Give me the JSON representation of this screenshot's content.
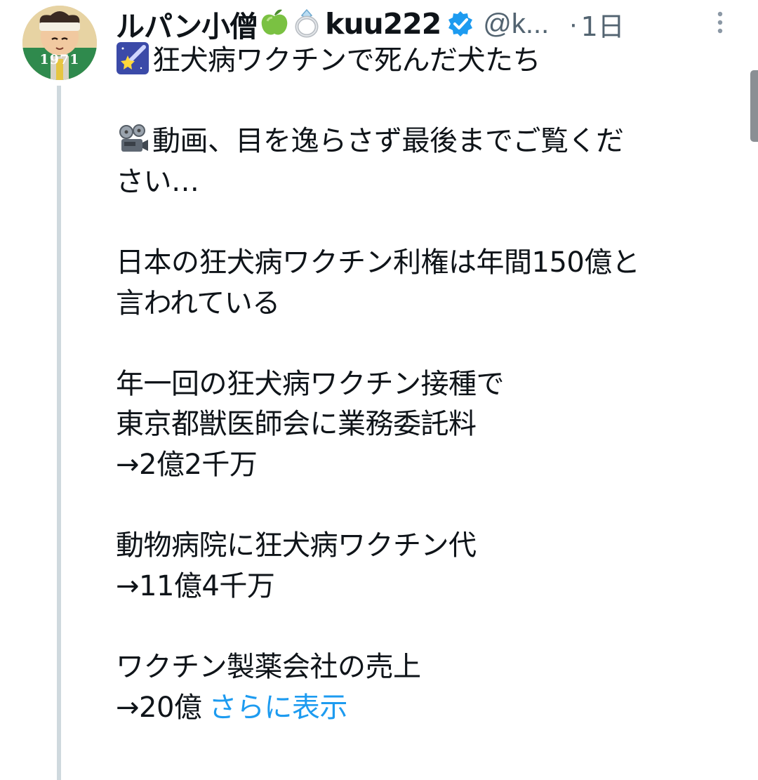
{
  "author": {
    "display_name": "ルパン小僧",
    "name_emojis": [
      "green-apple-emoji",
      "ring-emoji"
    ],
    "name_suffix": "kuu222",
    "handle": "@k...",
    "separator": "·",
    "timestamp": "1日",
    "verified": true,
    "avatar_caption": "1971"
  },
  "tweet": {
    "lines": [
      {
        "icon": "shooting-star-icon",
        "text": "狂犬病ワクチンで死んだ犬たち"
      },
      {
        "gap": true
      },
      {
        "icon": "film-projector-icon",
        "text": "動画、目を逸らさず最後までご覧くだ"
      },
      {
        "text": "さい…"
      },
      {
        "gap": true
      },
      {
        "text": "日本の狂犬病ワクチン利権は年間150億と"
      },
      {
        "text": "言われている"
      },
      {
        "gap": true
      },
      {
        "text": "年一回の狂犬病ワクチン接種で"
      },
      {
        "text": "東京都獣医師会に業務委託料"
      },
      {
        "text": "→2億2千万"
      },
      {
        "gap": true
      },
      {
        "text": "動物病院に狂犬病ワクチン代"
      },
      {
        "text": "→11億4千万"
      },
      {
        "gap": true
      },
      {
        "text": "ワクチン製薬会社の売上"
      },
      {
        "text": "→20億"
      }
    ],
    "show_more_label": "さらに表示"
  },
  "colors": {
    "text": "#0f1419",
    "secondary": "#536471",
    "link": "#1d9bf0",
    "verified": "#1d9bf0",
    "thread_line": "#cfd9de"
  }
}
